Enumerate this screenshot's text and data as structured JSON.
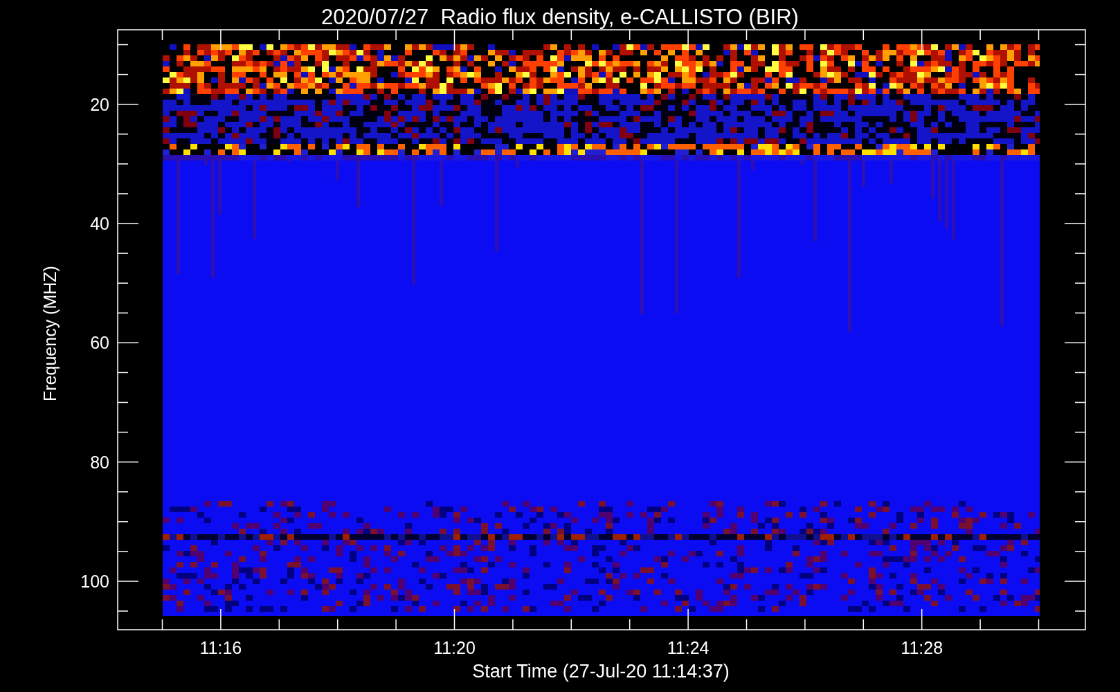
{
  "title": "2020/07/27  Radio flux density, e-CALLISTO (BIR)",
  "ylabel": "Frequency (MHZ)",
  "xlabel": "Start Time (27-Jul-20 11:14:37)",
  "yticks": [
    "20",
    "40",
    "60",
    "80",
    "100"
  ],
  "xticks": [
    "11:16",
    "11:20",
    "11:24",
    "11:28"
  ]
}
